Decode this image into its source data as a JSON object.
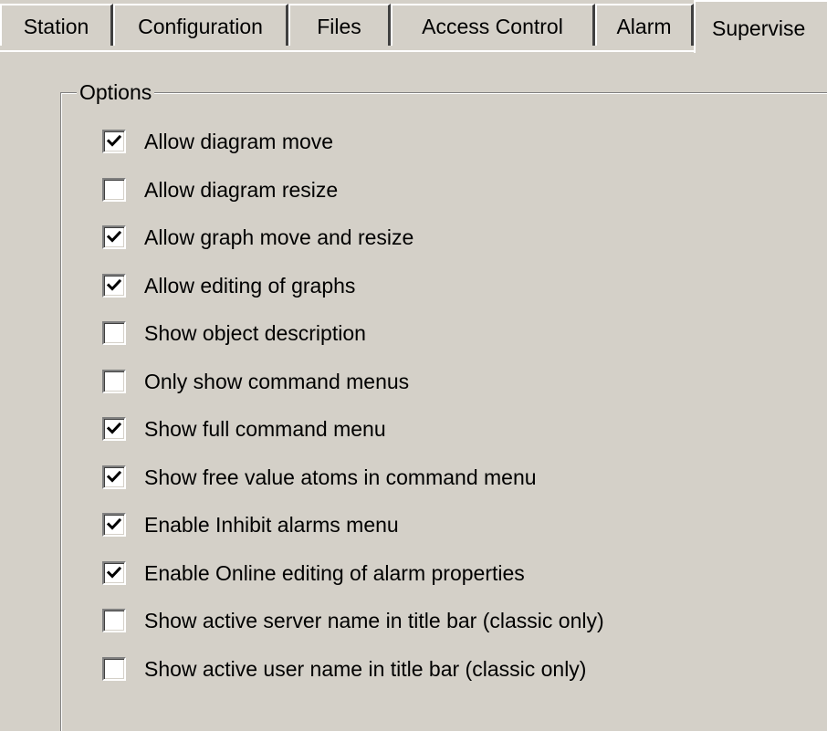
{
  "tabs": [
    {
      "label": "Station",
      "active": false
    },
    {
      "label": "Configuration",
      "active": false
    },
    {
      "label": "Files",
      "active": false
    },
    {
      "label": "Access Control",
      "active": false
    },
    {
      "label": "Alarm",
      "active": false
    },
    {
      "label": "Supervise",
      "active": true
    }
  ],
  "options_group": {
    "legend": "Options",
    "items": [
      {
        "label": "Allow diagram move",
        "checked": true
      },
      {
        "label": "Allow diagram resize",
        "checked": false
      },
      {
        "label": "Allow graph move and resize",
        "checked": true
      },
      {
        "label": "Allow editing of graphs",
        "checked": true
      },
      {
        "label": "Show object description",
        "checked": false
      },
      {
        "label": "Only show command menus",
        "checked": false
      },
      {
        "label": "Show full command menu",
        "checked": true
      },
      {
        "label": "Show free value atoms in command menu",
        "checked": true
      },
      {
        "label": "Enable Inhibit alarms menu",
        "checked": true
      },
      {
        "label": "Enable Online editing of alarm properties",
        "checked": true
      },
      {
        "label": "Show active server name in title bar (classic only)",
        "checked": false
      },
      {
        "label": "Show active user name in title bar (classic only)",
        "checked": false
      }
    ]
  },
  "colors": {
    "face": "#d4d0c8",
    "highlight": "#ffffff",
    "shadow": "#808080",
    "dark_shadow": "#404040"
  },
  "icons": {
    "check": "check-mark-icon"
  }
}
